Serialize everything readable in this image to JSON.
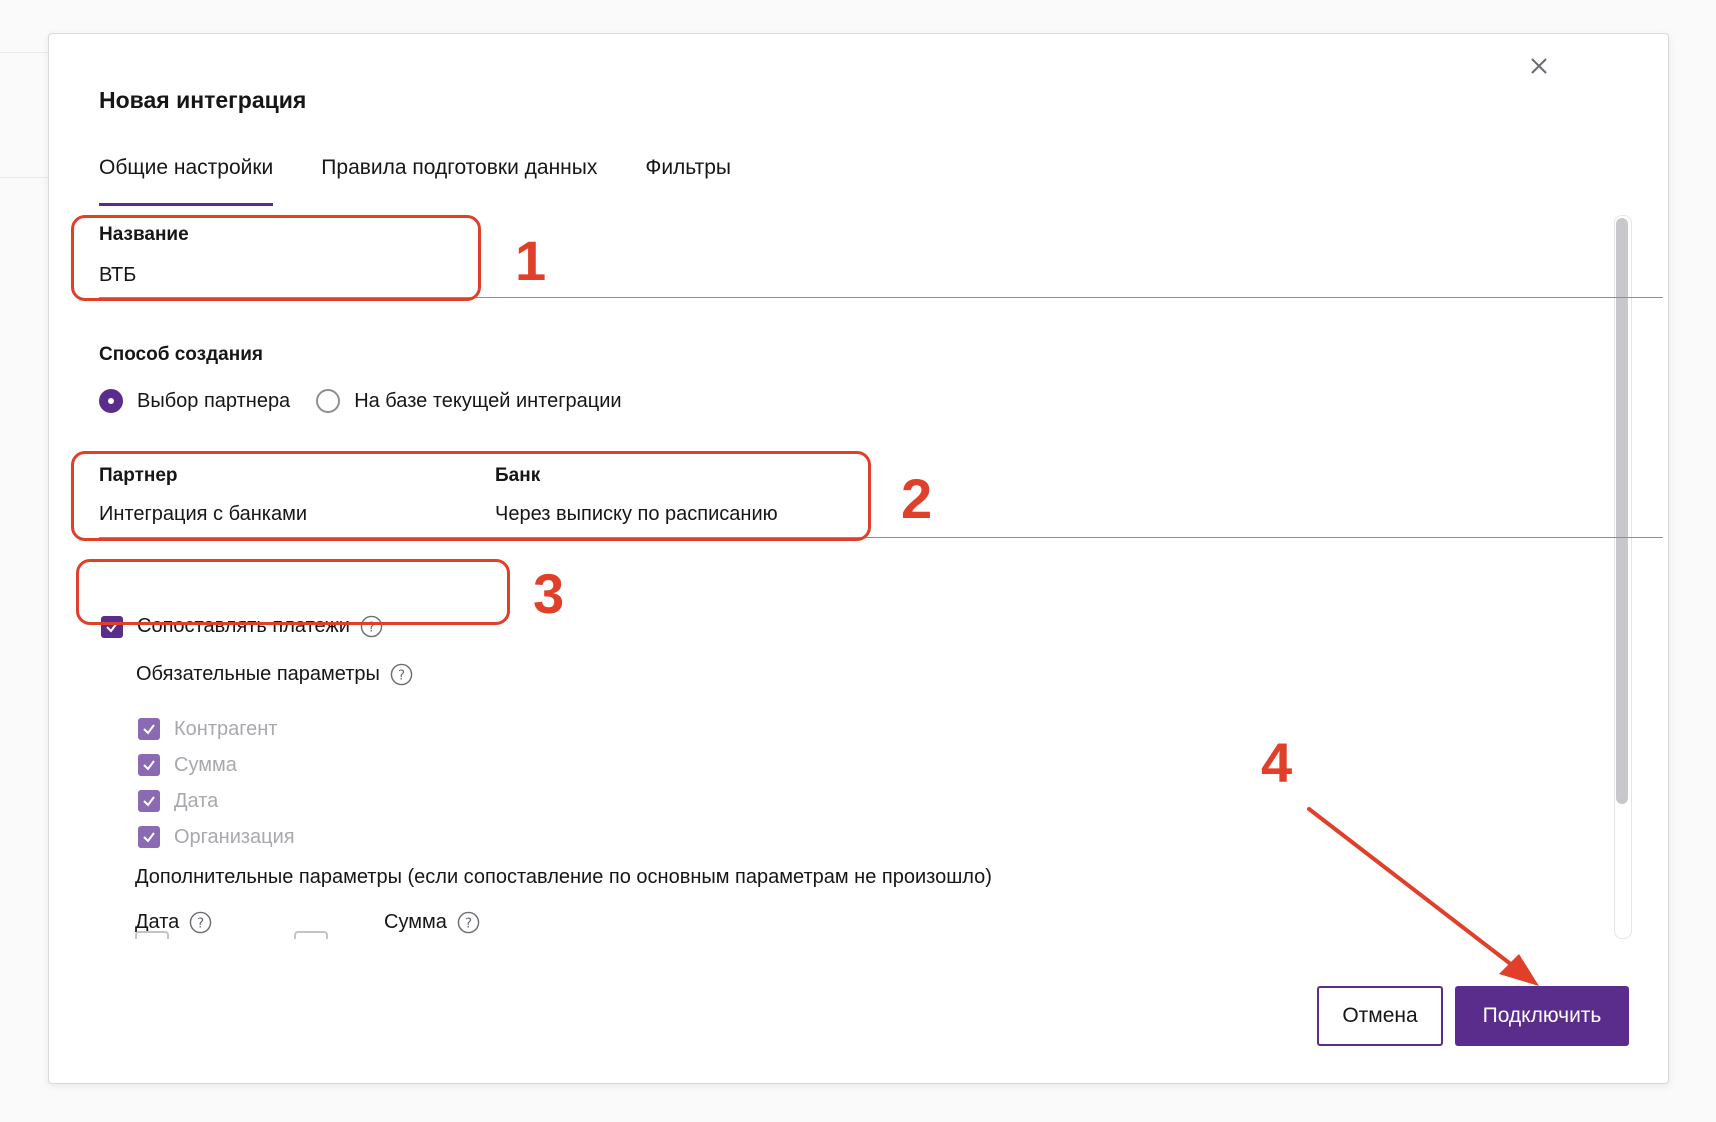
{
  "dialog": {
    "title": "Новая интеграция",
    "close_icon": "close-icon"
  },
  "tabs": [
    {
      "label": "Общие настройки",
      "active": true
    },
    {
      "label": "Правила подготовки данных",
      "active": false
    },
    {
      "label": "Фильтры",
      "active": false
    }
  ],
  "name_field": {
    "label": "Название",
    "value": "ВТБ"
  },
  "creation_method": {
    "label": "Способ создания",
    "options": [
      {
        "label": "Выбор партнера",
        "selected": true
      },
      {
        "label": "На базе текущей интеграции",
        "selected": false
      }
    ]
  },
  "partner_field": {
    "label": "Партнер",
    "value": "Интеграция с банками"
  },
  "bank_field": {
    "label": "Банк",
    "value": "Через выписку по расписанию"
  },
  "match_payments": {
    "label": "Сопоставлять платежи",
    "checked": true,
    "help_icon": "question-circle-icon"
  },
  "required_params": {
    "label": "Обязательные параметры",
    "items": [
      {
        "label": "Контрагент",
        "checked": true,
        "disabled": true
      },
      {
        "label": "Сумма",
        "checked": true,
        "disabled": true
      },
      {
        "label": "Дата",
        "checked": true,
        "disabled": true
      },
      {
        "label": "Организация",
        "checked": true,
        "disabled": true
      }
    ]
  },
  "additional_params": {
    "label": "Дополнительные параметры (если сопоставление по основным параметрам не произошло)",
    "date_label": "Дата",
    "sum_label": "Сумма"
  },
  "footer": {
    "cancel_label": "Отмена",
    "connect_label": "Подключить"
  },
  "annotations": {
    "n1": "1",
    "n2": "2",
    "n3": "3",
    "n4": "4"
  },
  "colors": {
    "accent": "#5a2d8c",
    "annotation": "#e0402a"
  }
}
